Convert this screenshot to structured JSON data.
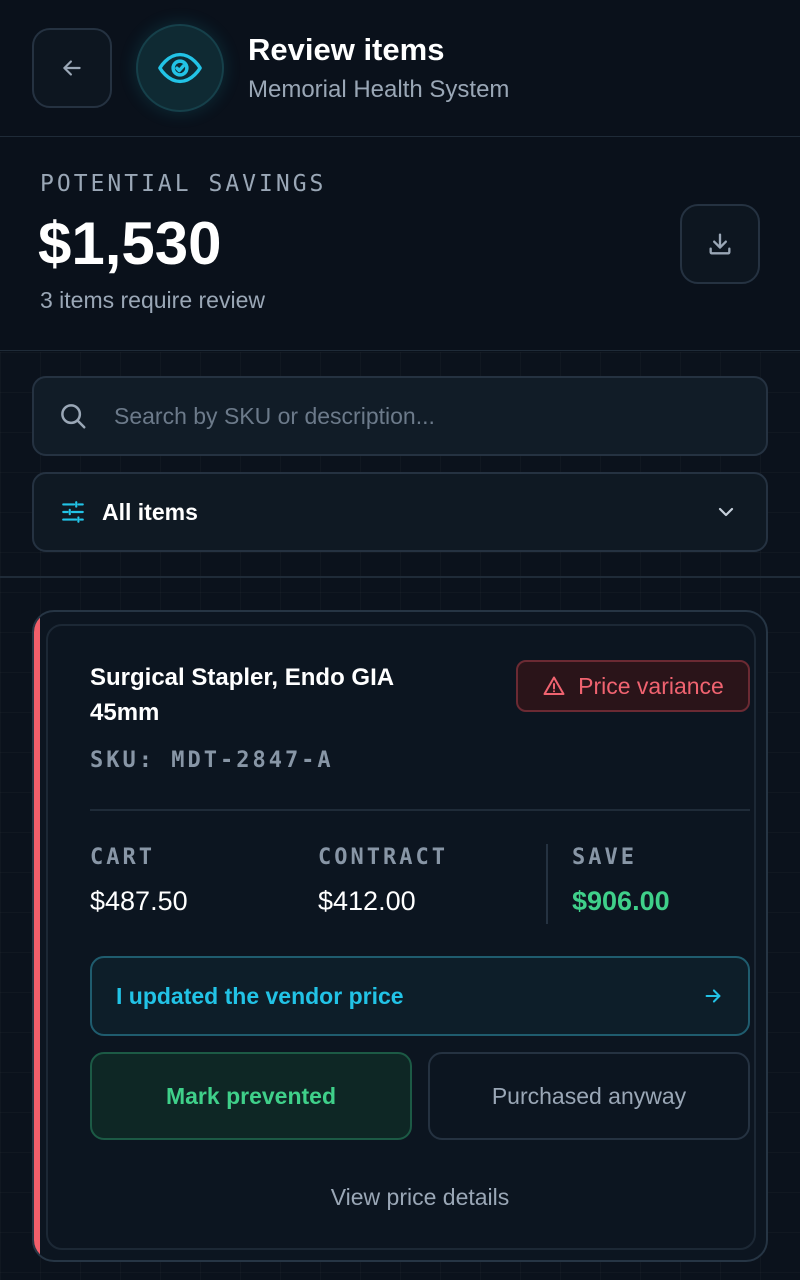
{
  "header": {
    "title": "Review items",
    "subtitle": "Memorial Health System",
    "back_icon": "arrow-left-icon",
    "badge_icon": "eye-check-icon"
  },
  "savings": {
    "label": "POTENTIAL SAVINGS",
    "value": "$1,530",
    "note": "3 items require review",
    "download_icon": "download-icon"
  },
  "search": {
    "placeholder": "Search by SKU or description...",
    "value": ""
  },
  "filter": {
    "label": "All items",
    "icon": "sliders-icon"
  },
  "item": {
    "title": "Surgical Stapler, Endo GIA 45mm",
    "badge": "Price variance",
    "sku": "SKU: MDT-2847-A",
    "cart_label": "CART",
    "cart_value": "$487.50",
    "contract_label": "CONTRACT",
    "contract_value": "$412.00",
    "save_label": "SAVE",
    "save_value": "$906.00",
    "update_label": "I updated the vendor price",
    "prevent_label": "Mark prevented",
    "purchased_label": "Purchased anyway",
    "details_label": "View price details"
  },
  "colors": {
    "background": "#0a111b",
    "accent_cyan": "#22c3e6",
    "accent_green": "#3fd08a",
    "accent_red": "#f06370"
  }
}
